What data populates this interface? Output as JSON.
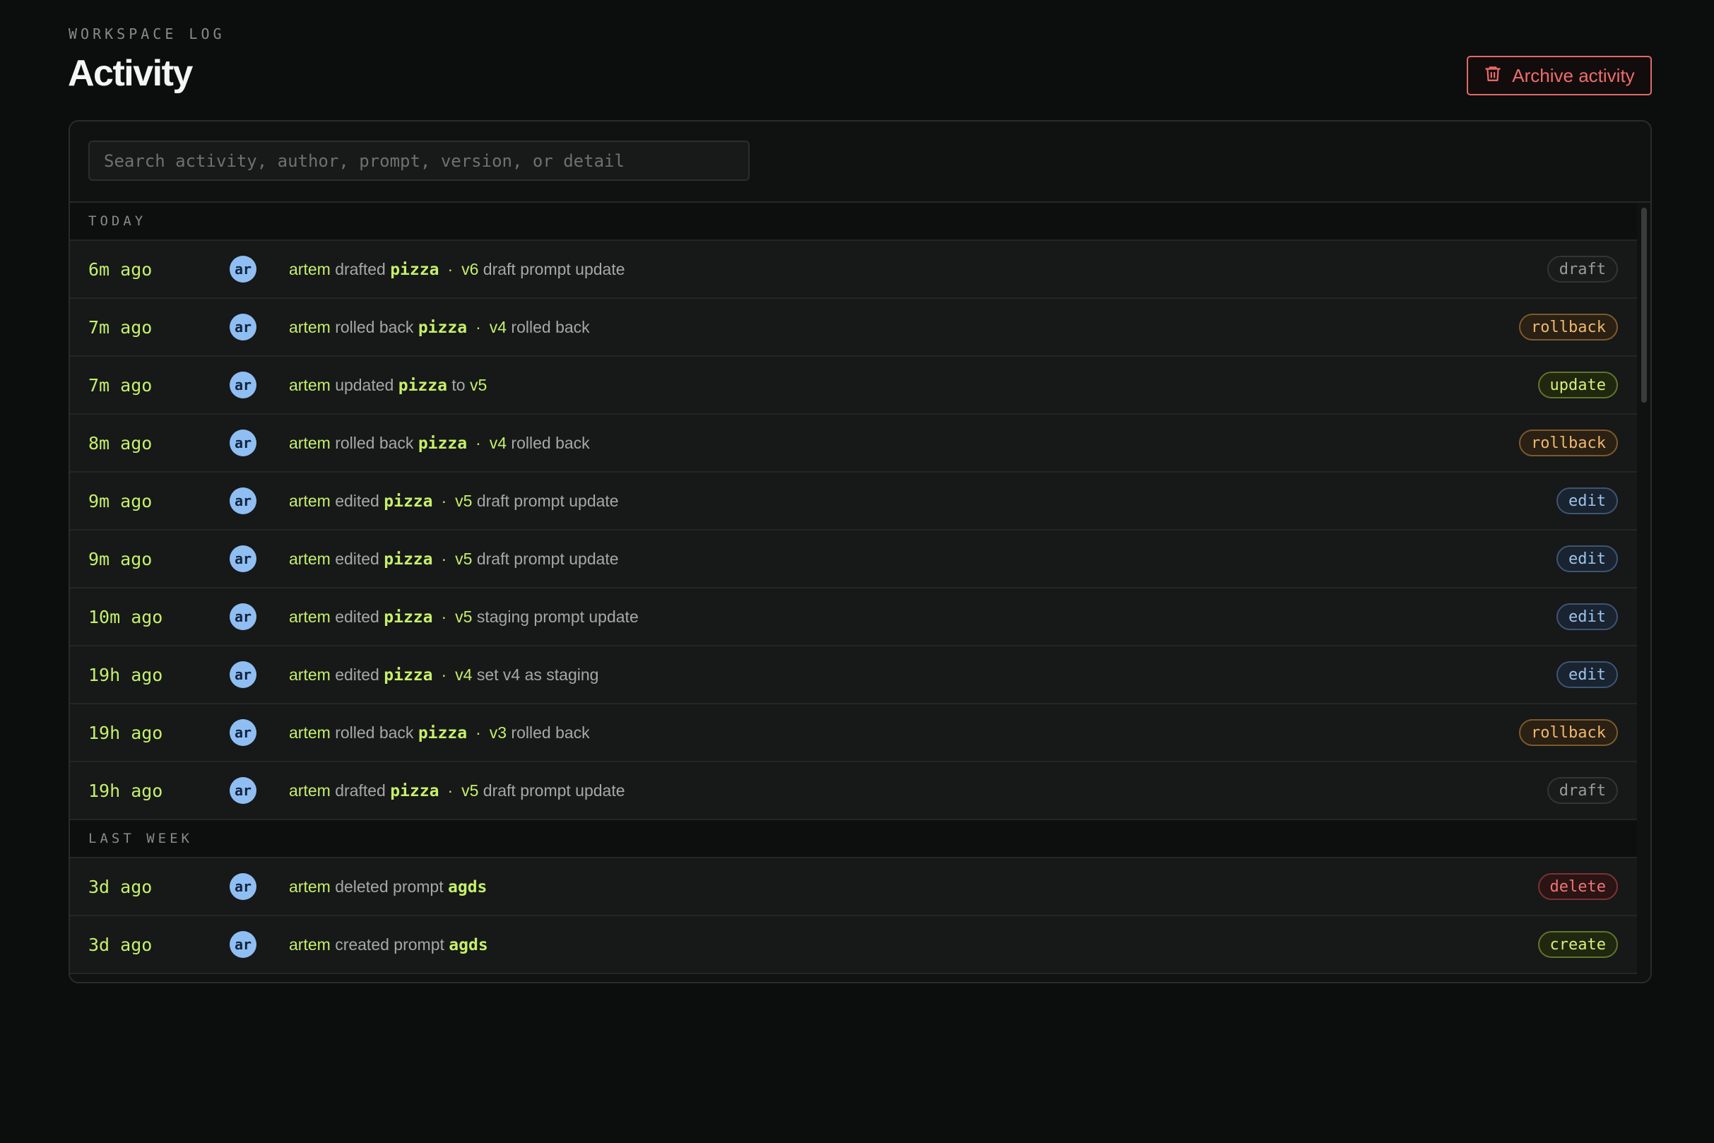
{
  "header": {
    "eyebrow": "WORKSPACE LOG",
    "title": "Activity",
    "archive_label": "Archive activity"
  },
  "search": {
    "placeholder": "Search activity, author, prompt, version, or detail"
  },
  "colors": {
    "accent": "#c5f06a",
    "danger": "#ee6d6d",
    "avatar": "#8fbef3"
  },
  "groups": [
    {
      "label": "TODAY",
      "rows": [
        {
          "time": "6m ago",
          "initials": "ar",
          "author": "artem",
          "verb": "drafted",
          "prompt": "pizza",
          "sep": "·",
          "version": "v6",
          "detail": "draft prompt update",
          "badge": "draft"
        },
        {
          "time": "7m ago",
          "initials": "ar",
          "author": "artem",
          "verb": "rolled back",
          "prompt": "pizza",
          "sep": "·",
          "version": "v4",
          "detail": "rolled back",
          "badge": "rollback"
        },
        {
          "time": "7m ago",
          "initials": "ar",
          "author": "artem",
          "verb": "updated",
          "prompt": "pizza",
          "sep": "",
          "connector": "to",
          "version": "v5",
          "detail": "",
          "badge": "update"
        },
        {
          "time": "8m ago",
          "initials": "ar",
          "author": "artem",
          "verb": "rolled back",
          "prompt": "pizza",
          "sep": "·",
          "version": "v4",
          "detail": "rolled back",
          "badge": "rollback"
        },
        {
          "time": "9m ago",
          "initials": "ar",
          "author": "artem",
          "verb": "edited",
          "prompt": "pizza",
          "sep": "·",
          "version": "v5",
          "detail": "draft prompt update",
          "badge": "edit"
        },
        {
          "time": "9m ago",
          "initials": "ar",
          "author": "artem",
          "verb": "edited",
          "prompt": "pizza",
          "sep": "·",
          "version": "v5",
          "detail": "draft prompt update",
          "badge": "edit"
        },
        {
          "time": "10m ago",
          "initials": "ar",
          "author": "artem",
          "verb": "edited",
          "prompt": "pizza",
          "sep": "·",
          "version": "v5",
          "detail": "staging prompt update",
          "badge": "edit"
        },
        {
          "time": "19h ago",
          "initials": "ar",
          "author": "artem",
          "verb": "edited",
          "prompt": "pizza",
          "sep": "·",
          "version": "v4",
          "detail": "set v4 as staging",
          "badge": "edit"
        },
        {
          "time": "19h ago",
          "initials": "ar",
          "author": "artem",
          "verb": "rolled back",
          "prompt": "pizza",
          "sep": "·",
          "version": "v3",
          "detail": "rolled back",
          "badge": "rollback"
        },
        {
          "time": "19h ago",
          "initials": "ar",
          "author": "artem",
          "verb": "drafted",
          "prompt": "pizza",
          "sep": "·",
          "version": "v5",
          "detail": "draft prompt update",
          "badge": "draft"
        }
      ]
    },
    {
      "label": "LAST WEEK",
      "rows": [
        {
          "time": "3d ago",
          "initials": "ar",
          "author": "artem",
          "verb": "deleted prompt",
          "prompt": "agds",
          "sep": "",
          "version": "",
          "detail": "",
          "badge": "delete"
        },
        {
          "time": "3d ago",
          "initials": "ar",
          "author": "artem",
          "verb": "created prompt",
          "prompt": "agds",
          "sep": "",
          "version": "",
          "detail": "",
          "badge": "create"
        }
      ]
    }
  ]
}
